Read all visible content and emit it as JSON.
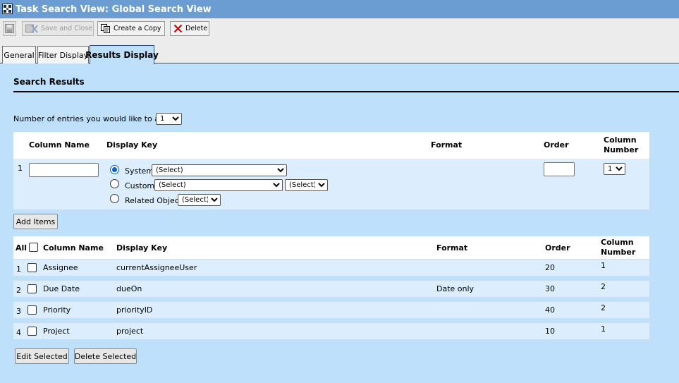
{
  "window": {
    "title": "Task Search View: Global Search View"
  },
  "toolbar": {
    "save_and_close": "Save and Close",
    "create_copy": "Create a Copy",
    "delete": "Delete"
  },
  "tabs": [
    {
      "label": "General",
      "active": false
    },
    {
      "label": "Filter Display",
      "active": false
    },
    {
      "label": "Results Display",
      "active": true
    }
  ],
  "section": {
    "title": "Search Results"
  },
  "entries": {
    "label": "Number of entries you would like to add:",
    "value": "1"
  },
  "add_form": {
    "headers": {
      "column_name": "Column Name",
      "display_key": "Display Key",
      "format": "Format",
      "order": "Order",
      "column_number": "Column Number"
    },
    "row_number": "1",
    "column_name_value": "",
    "display_key_options": [
      {
        "label": "System",
        "checked": true,
        "select_value": "(Select)"
      },
      {
        "label": "Custom",
        "checked": false,
        "select_value": "(Select)",
        "extra_select_value": "(Select)"
      },
      {
        "label": "Related Object",
        "checked": false,
        "select_value": "(Select)"
      }
    ],
    "order_value": "",
    "column_number_value": "1",
    "add_items_label": "Add Items"
  },
  "results_table": {
    "headers": {
      "all": "All",
      "column_name": "Column Name",
      "display_key": "Display Key",
      "format": "Format",
      "order": "Order",
      "column_number": "Column Number"
    },
    "rows": [
      {
        "num": "1",
        "column_name": "Assignee",
        "display_key": "currentAssigneeUser",
        "format": "",
        "order": "20",
        "column_number": "1"
      },
      {
        "num": "2",
        "column_name": "Due Date",
        "display_key": "dueOn",
        "format": "Date only",
        "order": "30",
        "column_number": "2"
      },
      {
        "num": "3",
        "column_name": "Priority",
        "display_key": "priorityID",
        "format": "",
        "order": "40",
        "column_number": "2"
      },
      {
        "num": "4",
        "column_name": "Project",
        "display_key": "project",
        "format": "",
        "order": "10",
        "column_number": "1"
      }
    ]
  },
  "actions": {
    "edit_selected": "Edit Selected",
    "delete_selected": "Delete Selected"
  },
  "colors": {
    "title_bar": "#6b9dd3",
    "content_bg": "#bfe0fb",
    "row_bg": "#dcedfd",
    "radio_accent": "#0b62c8",
    "delete_icon": "#d40000"
  }
}
